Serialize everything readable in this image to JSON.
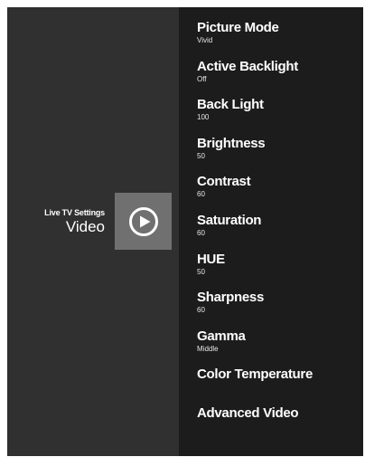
{
  "section": {
    "subtitle": "Live TV Settings",
    "title": "Video",
    "icon": "play-circle-icon"
  },
  "menu": {
    "items": [
      {
        "label": "Picture Mode",
        "value": "Vivid"
      },
      {
        "label": "Active Backlight",
        "value": "Off"
      },
      {
        "label": "Back Light",
        "value": "100"
      },
      {
        "label": "Brightness",
        "value": "50"
      },
      {
        "label": "Contrast",
        "value": "60"
      },
      {
        "label": "Saturation",
        "value": "60"
      },
      {
        "label": "HUE",
        "value": "50"
      },
      {
        "label": "Sharpness",
        "value": "60"
      },
      {
        "label": "Gamma",
        "value": "Middle"
      },
      {
        "label": "Color Temperature",
        "value": ""
      },
      {
        "label": "Advanced Video",
        "value": ""
      }
    ]
  },
  "colors": {
    "left_panel": "#303030",
    "right_panel": "#1c1c1c",
    "tile": "#707070",
    "text": "#ffffff"
  }
}
